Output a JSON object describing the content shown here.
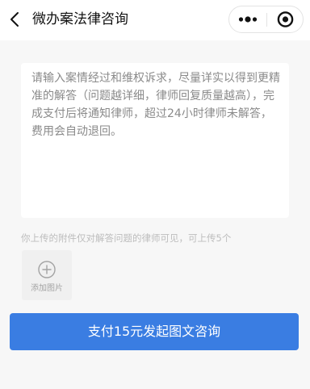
{
  "header": {
    "title": "微办案法律咨询",
    "back_icon": "chevron-left-icon",
    "more_icon": "more-dots-icon",
    "close_icon": "record-close-icon"
  },
  "question": {
    "placeholder": "请输入案情经过和维权诉求，尽量详实以得到更精准的解答（问题越详细，律师回复质量越高），完成支付后将通知律师，超过24小时律师未解答，费用会自动退回。",
    "value": ""
  },
  "attachments": {
    "hint": "你上传的附件仅对解答问题的律师可见，可上传5个",
    "add_label": "添加图片",
    "add_icon": "plus-circle-icon"
  },
  "submit": {
    "label": "支付15元发起图文咨询"
  },
  "colors": {
    "primary": "#3a7de2",
    "background": "#f7f7f7",
    "hint_text": "#bdbdbd",
    "placeholder_text": "#8a8a8a"
  }
}
